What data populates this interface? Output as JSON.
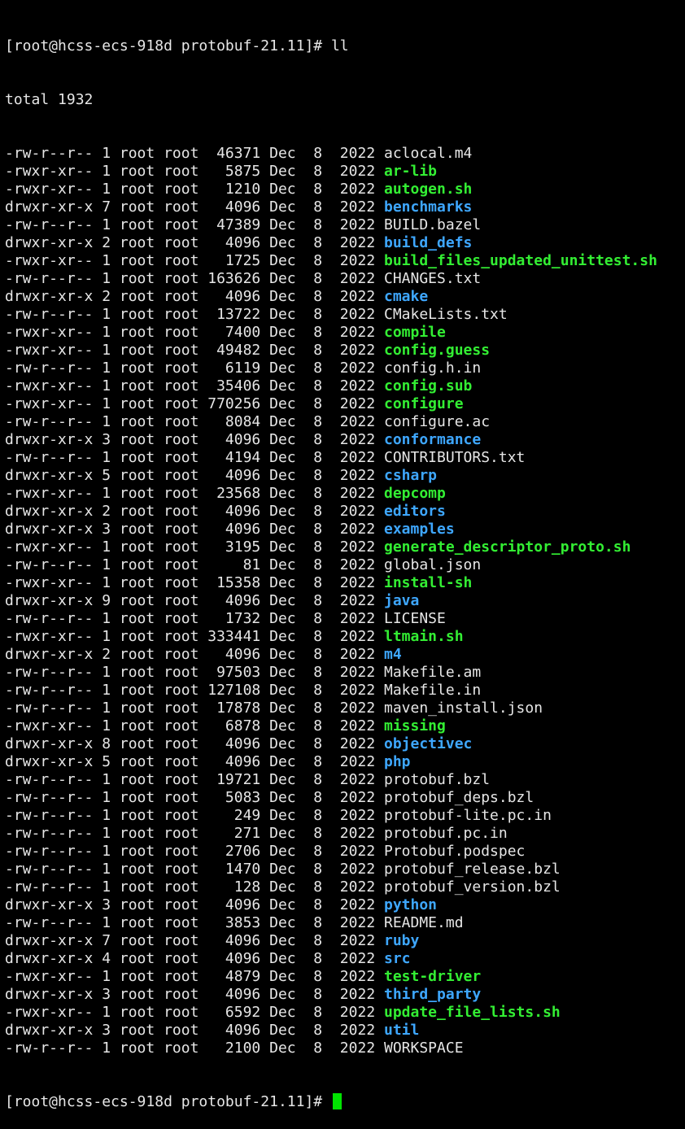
{
  "colors": {
    "background": "#000000",
    "text": "#e6e6e6",
    "directory": "#3ea7ff",
    "executable": "#33ee33",
    "cursor": "#00e400"
  },
  "prompt": "[root@hcss-ecs-918d protobuf-21.11]# ",
  "command": "ll",
  "total": "total 1932",
  "entries": [
    {
      "perms": "-rw-r--r--",
      "links": "1",
      "owner": "root",
      "group": "root",
      "size": "46371",
      "month": "Dec",
      "day": "8",
      "year": "2022",
      "name": "aclocal.m4",
      "kind": "file"
    },
    {
      "perms": "-rwxr-xr--",
      "links": "1",
      "owner": "root",
      "group": "root",
      "size": "5875",
      "month": "Dec",
      "day": "8",
      "year": "2022",
      "name": "ar-lib",
      "kind": "exec"
    },
    {
      "perms": "-rwxr-xr--",
      "links": "1",
      "owner": "root",
      "group": "root",
      "size": "1210",
      "month": "Dec",
      "day": "8",
      "year": "2022",
      "name": "autogen.sh",
      "kind": "exec"
    },
    {
      "perms": "drwxr-xr-x",
      "links": "7",
      "owner": "root",
      "group": "root",
      "size": "4096",
      "month": "Dec",
      "day": "8",
      "year": "2022",
      "name": "benchmarks",
      "kind": "dir"
    },
    {
      "perms": "-rw-r--r--",
      "links": "1",
      "owner": "root",
      "group": "root",
      "size": "47389",
      "month": "Dec",
      "day": "8",
      "year": "2022",
      "name": "BUILD.bazel",
      "kind": "file"
    },
    {
      "perms": "drwxr-xr-x",
      "links": "2",
      "owner": "root",
      "group": "root",
      "size": "4096",
      "month": "Dec",
      "day": "8",
      "year": "2022",
      "name": "build_defs",
      "kind": "dir"
    },
    {
      "perms": "-rwxr-xr--",
      "links": "1",
      "owner": "root",
      "group": "root",
      "size": "1725",
      "month": "Dec",
      "day": "8",
      "year": "2022",
      "name": "build_files_updated_unittest.sh",
      "kind": "exec"
    },
    {
      "perms": "-rw-r--r--",
      "links": "1",
      "owner": "root",
      "group": "root",
      "size": "163626",
      "month": "Dec",
      "day": "8",
      "year": "2022",
      "name": "CHANGES.txt",
      "kind": "file"
    },
    {
      "perms": "drwxr-xr-x",
      "links": "2",
      "owner": "root",
      "group": "root",
      "size": "4096",
      "month": "Dec",
      "day": "8",
      "year": "2022",
      "name": "cmake",
      "kind": "dir"
    },
    {
      "perms": "-rw-r--r--",
      "links": "1",
      "owner": "root",
      "group": "root",
      "size": "13722",
      "month": "Dec",
      "day": "8",
      "year": "2022",
      "name": "CMakeLists.txt",
      "kind": "file"
    },
    {
      "perms": "-rwxr-xr--",
      "links": "1",
      "owner": "root",
      "group": "root",
      "size": "7400",
      "month": "Dec",
      "day": "8",
      "year": "2022",
      "name": "compile",
      "kind": "exec"
    },
    {
      "perms": "-rwxr-xr--",
      "links": "1",
      "owner": "root",
      "group": "root",
      "size": "49482",
      "month": "Dec",
      "day": "8",
      "year": "2022",
      "name": "config.guess",
      "kind": "exec"
    },
    {
      "perms": "-rw-r--r--",
      "links": "1",
      "owner": "root",
      "group": "root",
      "size": "6119",
      "month": "Dec",
      "day": "8",
      "year": "2022",
      "name": "config.h.in",
      "kind": "file"
    },
    {
      "perms": "-rwxr-xr--",
      "links": "1",
      "owner": "root",
      "group": "root",
      "size": "35406",
      "month": "Dec",
      "day": "8",
      "year": "2022",
      "name": "config.sub",
      "kind": "exec"
    },
    {
      "perms": "-rwxr-xr--",
      "links": "1",
      "owner": "root",
      "group": "root",
      "size": "770256",
      "month": "Dec",
      "day": "8",
      "year": "2022",
      "name": "configure",
      "kind": "exec"
    },
    {
      "perms": "-rw-r--r--",
      "links": "1",
      "owner": "root",
      "group": "root",
      "size": "8084",
      "month": "Dec",
      "day": "8",
      "year": "2022",
      "name": "configure.ac",
      "kind": "file"
    },
    {
      "perms": "drwxr-xr-x",
      "links": "3",
      "owner": "root",
      "group": "root",
      "size": "4096",
      "month": "Dec",
      "day": "8",
      "year": "2022",
      "name": "conformance",
      "kind": "dir"
    },
    {
      "perms": "-rw-r--r--",
      "links": "1",
      "owner": "root",
      "group": "root",
      "size": "4194",
      "month": "Dec",
      "day": "8",
      "year": "2022",
      "name": "CONTRIBUTORS.txt",
      "kind": "file"
    },
    {
      "perms": "drwxr-xr-x",
      "links": "5",
      "owner": "root",
      "group": "root",
      "size": "4096",
      "month": "Dec",
      "day": "8",
      "year": "2022",
      "name": "csharp",
      "kind": "dir"
    },
    {
      "perms": "-rwxr-xr--",
      "links": "1",
      "owner": "root",
      "group": "root",
      "size": "23568",
      "month": "Dec",
      "day": "8",
      "year": "2022",
      "name": "depcomp",
      "kind": "exec"
    },
    {
      "perms": "drwxr-xr-x",
      "links": "2",
      "owner": "root",
      "group": "root",
      "size": "4096",
      "month": "Dec",
      "day": "8",
      "year": "2022",
      "name": "editors",
      "kind": "dir"
    },
    {
      "perms": "drwxr-xr-x",
      "links": "3",
      "owner": "root",
      "group": "root",
      "size": "4096",
      "month": "Dec",
      "day": "8",
      "year": "2022",
      "name": "examples",
      "kind": "dir"
    },
    {
      "perms": "-rwxr-xr--",
      "links": "1",
      "owner": "root",
      "group": "root",
      "size": "3195",
      "month": "Dec",
      "day": "8",
      "year": "2022",
      "name": "generate_descriptor_proto.sh",
      "kind": "exec"
    },
    {
      "perms": "-rw-r--r--",
      "links": "1",
      "owner": "root",
      "group": "root",
      "size": "81",
      "month": "Dec",
      "day": "8",
      "year": "2022",
      "name": "global.json",
      "kind": "file"
    },
    {
      "perms": "-rwxr-xr--",
      "links": "1",
      "owner": "root",
      "group": "root",
      "size": "15358",
      "month": "Dec",
      "day": "8",
      "year": "2022",
      "name": "install-sh",
      "kind": "exec"
    },
    {
      "perms": "drwxr-xr-x",
      "links": "9",
      "owner": "root",
      "group": "root",
      "size": "4096",
      "month": "Dec",
      "day": "8",
      "year": "2022",
      "name": "java",
      "kind": "dir"
    },
    {
      "perms": "-rw-r--r--",
      "links": "1",
      "owner": "root",
      "group": "root",
      "size": "1732",
      "month": "Dec",
      "day": "8",
      "year": "2022",
      "name": "LICENSE",
      "kind": "file"
    },
    {
      "perms": "-rwxr-xr--",
      "links": "1",
      "owner": "root",
      "group": "root",
      "size": "333441",
      "month": "Dec",
      "day": "8",
      "year": "2022",
      "name": "ltmain.sh",
      "kind": "exec"
    },
    {
      "perms": "drwxr-xr-x",
      "links": "2",
      "owner": "root",
      "group": "root",
      "size": "4096",
      "month": "Dec",
      "day": "8",
      "year": "2022",
      "name": "m4",
      "kind": "dir"
    },
    {
      "perms": "-rw-r--r--",
      "links": "1",
      "owner": "root",
      "group": "root",
      "size": "97503",
      "month": "Dec",
      "day": "8",
      "year": "2022",
      "name": "Makefile.am",
      "kind": "file"
    },
    {
      "perms": "-rw-r--r--",
      "links": "1",
      "owner": "root",
      "group": "root",
      "size": "127108",
      "month": "Dec",
      "day": "8",
      "year": "2022",
      "name": "Makefile.in",
      "kind": "file"
    },
    {
      "perms": "-rw-r--r--",
      "links": "1",
      "owner": "root",
      "group": "root",
      "size": "17878",
      "month": "Dec",
      "day": "8",
      "year": "2022",
      "name": "maven_install.json",
      "kind": "file"
    },
    {
      "perms": "-rwxr-xr--",
      "links": "1",
      "owner": "root",
      "group": "root",
      "size": "6878",
      "month": "Dec",
      "day": "8",
      "year": "2022",
      "name": "missing",
      "kind": "exec"
    },
    {
      "perms": "drwxr-xr-x",
      "links": "8",
      "owner": "root",
      "group": "root",
      "size": "4096",
      "month": "Dec",
      "day": "8",
      "year": "2022",
      "name": "objectivec",
      "kind": "dir"
    },
    {
      "perms": "drwxr-xr-x",
      "links": "5",
      "owner": "root",
      "group": "root",
      "size": "4096",
      "month": "Dec",
      "day": "8",
      "year": "2022",
      "name": "php",
      "kind": "dir"
    },
    {
      "perms": "-rw-r--r--",
      "links": "1",
      "owner": "root",
      "group": "root",
      "size": "19721",
      "month": "Dec",
      "day": "8",
      "year": "2022",
      "name": "protobuf.bzl",
      "kind": "file"
    },
    {
      "perms": "-rw-r--r--",
      "links": "1",
      "owner": "root",
      "group": "root",
      "size": "5083",
      "month": "Dec",
      "day": "8",
      "year": "2022",
      "name": "protobuf_deps.bzl",
      "kind": "file"
    },
    {
      "perms": "-rw-r--r--",
      "links": "1",
      "owner": "root",
      "group": "root",
      "size": "249",
      "month": "Dec",
      "day": "8",
      "year": "2022",
      "name": "protobuf-lite.pc.in",
      "kind": "file"
    },
    {
      "perms": "-rw-r--r--",
      "links": "1",
      "owner": "root",
      "group": "root",
      "size": "271",
      "month": "Dec",
      "day": "8",
      "year": "2022",
      "name": "protobuf.pc.in",
      "kind": "file"
    },
    {
      "perms": "-rw-r--r--",
      "links": "1",
      "owner": "root",
      "group": "root",
      "size": "2706",
      "month": "Dec",
      "day": "8",
      "year": "2022",
      "name": "Protobuf.podspec",
      "kind": "file"
    },
    {
      "perms": "-rw-r--r--",
      "links": "1",
      "owner": "root",
      "group": "root",
      "size": "1470",
      "month": "Dec",
      "day": "8",
      "year": "2022",
      "name": "protobuf_release.bzl",
      "kind": "file"
    },
    {
      "perms": "-rw-r--r--",
      "links": "1",
      "owner": "root",
      "group": "root",
      "size": "128",
      "month": "Dec",
      "day": "8",
      "year": "2022",
      "name": "protobuf_version.bzl",
      "kind": "file"
    },
    {
      "perms": "drwxr-xr-x",
      "links": "3",
      "owner": "root",
      "group": "root",
      "size": "4096",
      "month": "Dec",
      "day": "8",
      "year": "2022",
      "name": "python",
      "kind": "dir"
    },
    {
      "perms": "-rw-r--r--",
      "links": "1",
      "owner": "root",
      "group": "root",
      "size": "3853",
      "month": "Dec",
      "day": "8",
      "year": "2022",
      "name": "README.md",
      "kind": "file"
    },
    {
      "perms": "drwxr-xr-x",
      "links": "7",
      "owner": "root",
      "group": "root",
      "size": "4096",
      "month": "Dec",
      "day": "8",
      "year": "2022",
      "name": "ruby",
      "kind": "dir"
    },
    {
      "perms": "drwxr-xr-x",
      "links": "4",
      "owner": "root",
      "group": "root",
      "size": "4096",
      "month": "Dec",
      "day": "8",
      "year": "2022",
      "name": "src",
      "kind": "dir"
    },
    {
      "perms": "-rwxr-xr--",
      "links": "1",
      "owner": "root",
      "group": "root",
      "size": "4879",
      "month": "Dec",
      "day": "8",
      "year": "2022",
      "name": "test-driver",
      "kind": "exec"
    },
    {
      "perms": "drwxr-xr-x",
      "links": "3",
      "owner": "root",
      "group": "root",
      "size": "4096",
      "month": "Dec",
      "day": "8",
      "year": "2022",
      "name": "third_party",
      "kind": "dir"
    },
    {
      "perms": "-rwxr-xr--",
      "links": "1",
      "owner": "root",
      "group": "root",
      "size": "6592",
      "month": "Dec",
      "day": "8",
      "year": "2022",
      "name": "update_file_lists.sh",
      "kind": "exec"
    },
    {
      "perms": "drwxr-xr-x",
      "links": "3",
      "owner": "root",
      "group": "root",
      "size": "4096",
      "month": "Dec",
      "day": "8",
      "year": "2022",
      "name": "util",
      "kind": "dir"
    },
    {
      "perms": "-rw-r--r--",
      "links": "1",
      "owner": "root",
      "group": "root",
      "size": "2100",
      "month": "Dec",
      "day": "8",
      "year": "2022",
      "name": "WORKSPACE",
      "kind": "file"
    }
  ],
  "final_prompt": "[root@hcss-ecs-918d protobuf-21.11]# "
}
